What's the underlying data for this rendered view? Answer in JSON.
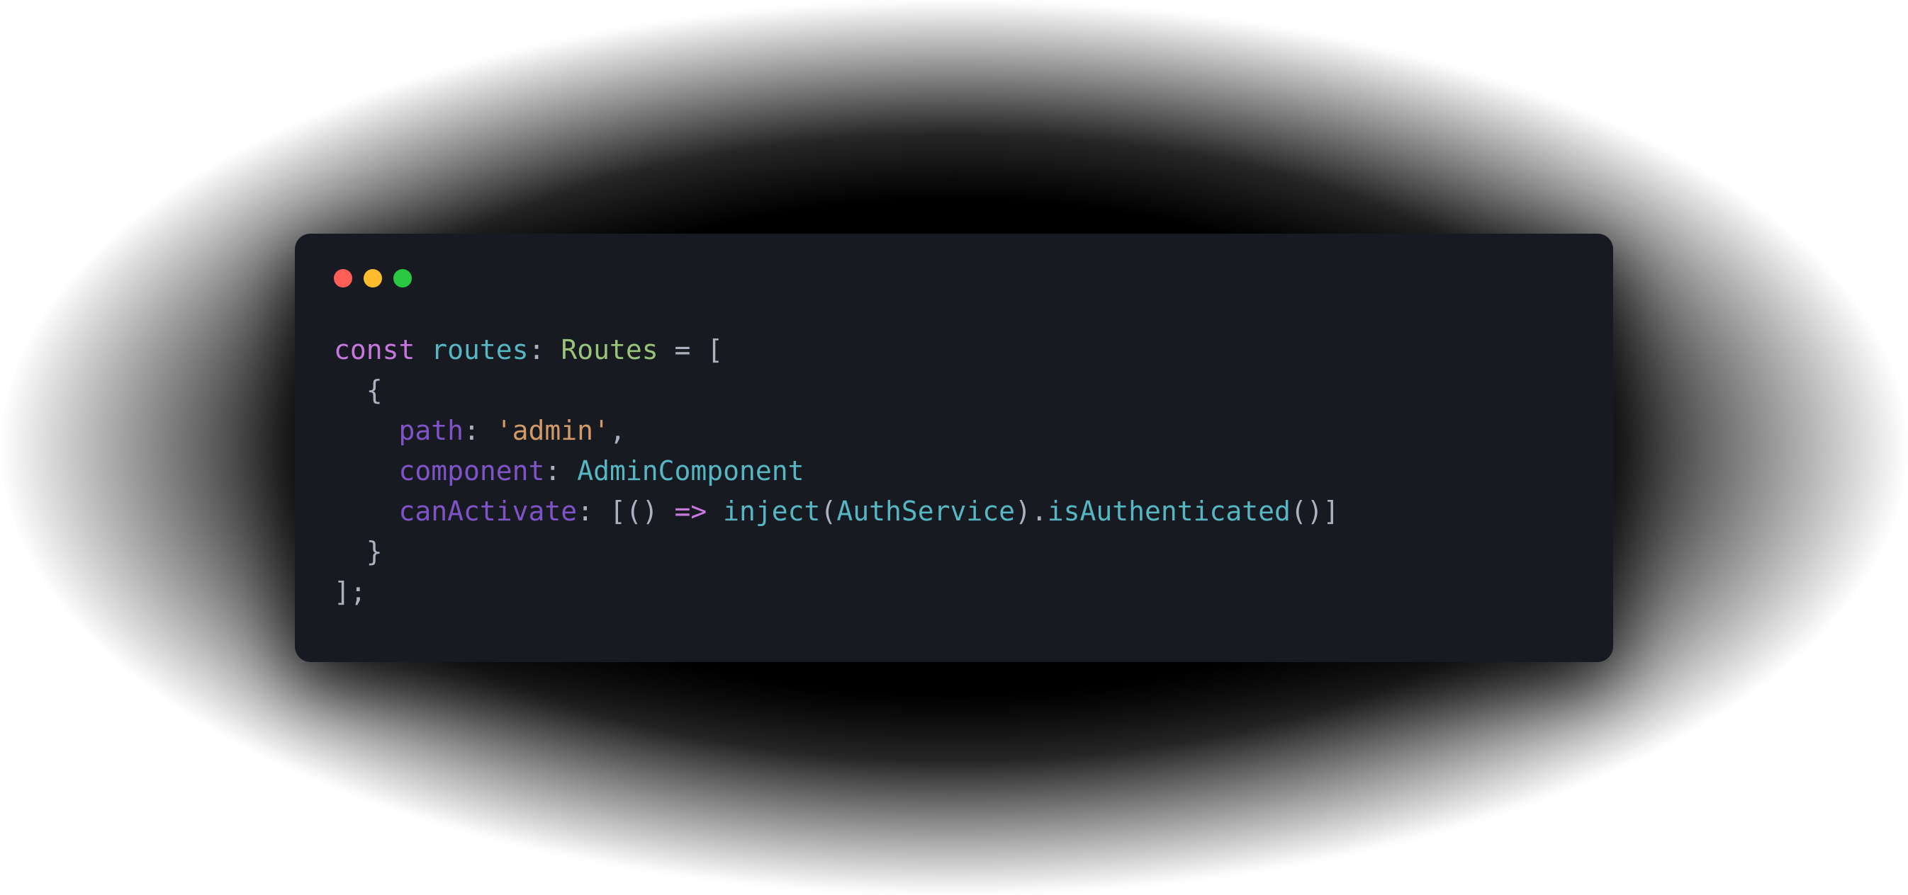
{
  "colors": {
    "window_bg": "#171a21",
    "traffic_red": "#ff5f57",
    "traffic_yellow": "#febc2e",
    "traffic_green": "#28c840",
    "keyword": "#c678dd",
    "variable": "#56b6c2",
    "type": "#98c379",
    "property": "#7f54c9",
    "string": "#d19a66",
    "default_text": "#abb2bf"
  },
  "code": {
    "raw": "const routes: Routes = [\n  {\n    path: 'admin',\n    component: AdminComponent\n    canActivate: [() => inject(AuthService).isAuthenticated()]\n  }\n];",
    "lines": [
      [
        {
          "text": "const",
          "cls": "tok-keyword"
        },
        {
          "text": " ",
          "cls": "tok-punct"
        },
        {
          "text": "routes",
          "cls": "tok-variable"
        },
        {
          "text": ": ",
          "cls": "tok-punct"
        },
        {
          "text": "Routes",
          "cls": "tok-type"
        },
        {
          "text": " = [",
          "cls": "tok-punct"
        }
      ],
      [
        {
          "text": "  {",
          "cls": "tok-punct"
        }
      ],
      [
        {
          "text": "    ",
          "cls": "tok-punct"
        },
        {
          "text": "path",
          "cls": "tok-prop"
        },
        {
          "text": ": ",
          "cls": "tok-punct"
        },
        {
          "text": "'admin'",
          "cls": "tok-string"
        },
        {
          "text": ",",
          "cls": "tok-punct"
        }
      ],
      [
        {
          "text": "    ",
          "cls": "tok-punct"
        },
        {
          "text": "component",
          "cls": "tok-prop"
        },
        {
          "text": ": ",
          "cls": "tok-punct"
        },
        {
          "text": "AdminComponent",
          "cls": "tok-class"
        }
      ],
      [
        {
          "text": "    ",
          "cls": "tok-punct"
        },
        {
          "text": "canActivate",
          "cls": "tok-prop"
        },
        {
          "text": ": [",
          "cls": "tok-punct"
        },
        {
          "text": "()",
          "cls": "tok-punct"
        },
        {
          "text": " ",
          "cls": "tok-punct"
        },
        {
          "text": "=>",
          "cls": "tok-arrow"
        },
        {
          "text": " ",
          "cls": "tok-punct"
        },
        {
          "text": "inject",
          "cls": "tok-func"
        },
        {
          "text": "(",
          "cls": "tok-punct"
        },
        {
          "text": "AuthService",
          "cls": "tok-class"
        },
        {
          "text": ").",
          "cls": "tok-punct"
        },
        {
          "text": "isAuthenticated",
          "cls": "tok-method"
        },
        {
          "text": "()]",
          "cls": "tok-punct"
        }
      ],
      [
        {
          "text": "  }",
          "cls": "tok-punct"
        }
      ],
      [
        {
          "text": "];",
          "cls": "tok-punct"
        }
      ]
    ]
  }
}
